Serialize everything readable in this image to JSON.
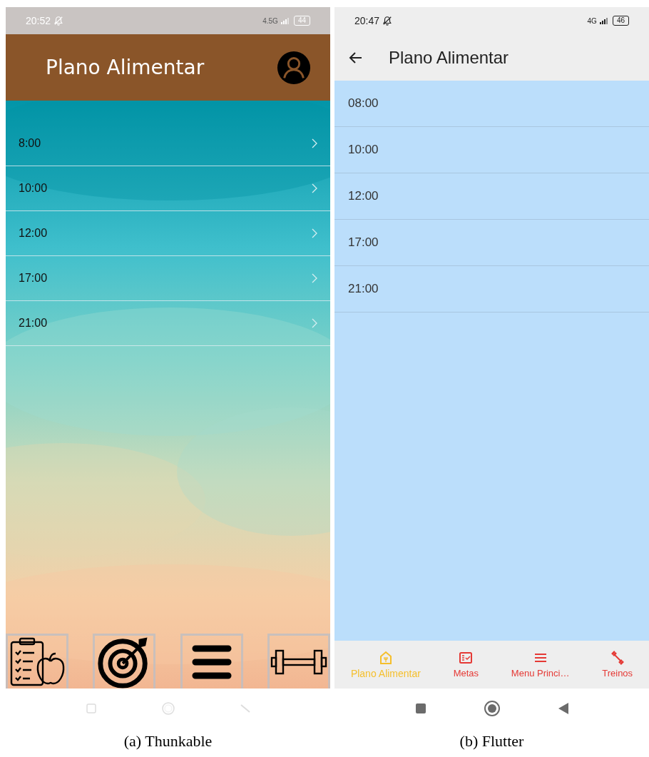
{
  "thunkable": {
    "status_bar": {
      "time": "20:52",
      "network": "4.5G",
      "battery": "44"
    },
    "title": "Plano Alimentar",
    "rows": [
      {
        "label": "8:00"
      },
      {
        "label": "10:00"
      },
      {
        "label": "12:00"
      },
      {
        "label": "17:00"
      },
      {
        "label": "21:00"
      }
    ],
    "caption": "(a) Thunkable"
  },
  "flutter": {
    "status_bar": {
      "time": "20:47",
      "network": "4G",
      "battery": "46"
    },
    "title": "Plano Alimentar",
    "rows": [
      {
        "label": "08:00"
      },
      {
        "label": "10:00"
      },
      {
        "label": "12:00"
      },
      {
        "label": "17:00"
      },
      {
        "label": "21:00"
      }
    ],
    "bottom_nav": [
      {
        "kind": "home",
        "label": "Plano Alimentar",
        "selected": true
      },
      {
        "kind": "goals",
        "label": "Metas",
        "selected": false
      },
      {
        "kind": "menu",
        "label": "Menu Princi…",
        "selected": false
      },
      {
        "kind": "training",
        "label": "Treinos",
        "selected": false
      }
    ],
    "caption": "(b) Flutter"
  }
}
